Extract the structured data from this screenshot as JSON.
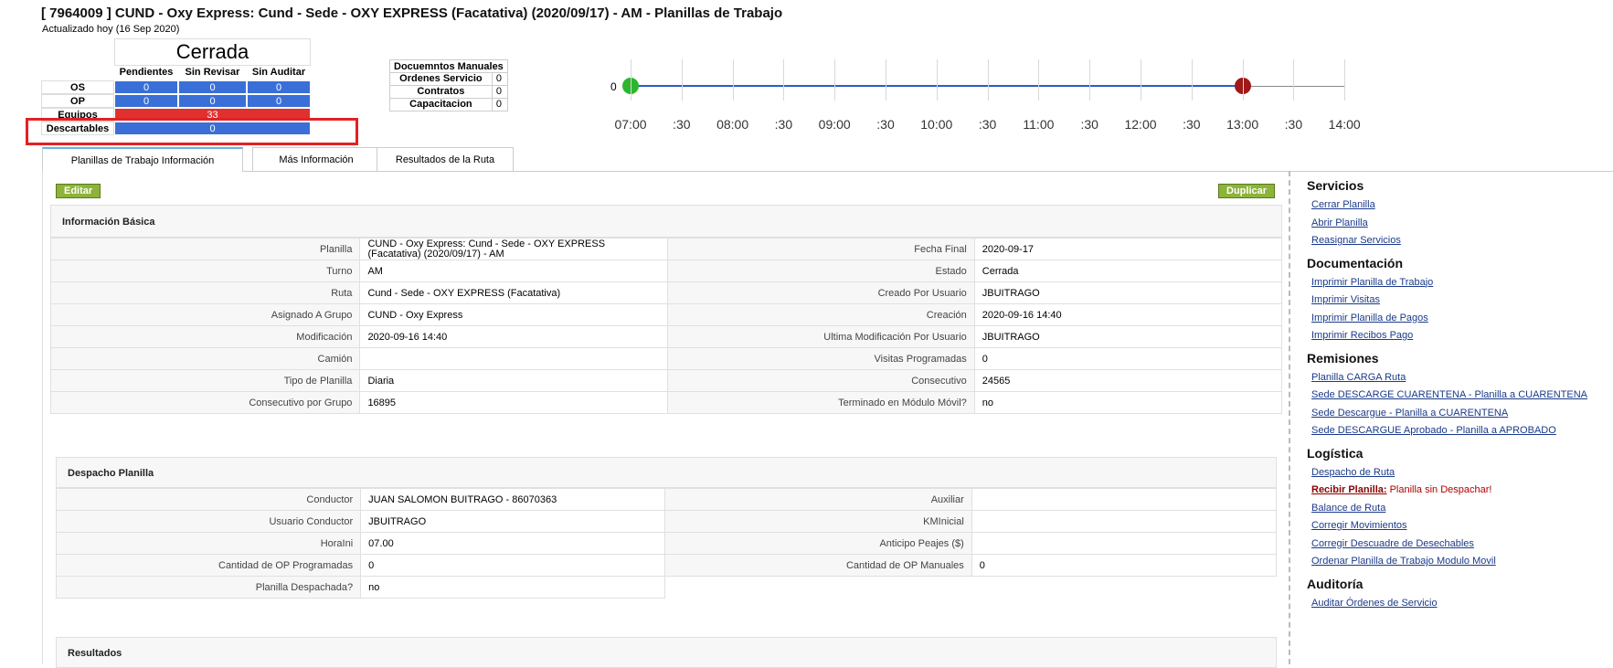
{
  "header": {
    "title": "[ 7964009 ] CUND - Oxy Express: Cund - Sede - OXY EXPRESS (Facatativa) (2020/09/17) - AM - Planillas de Trabajo",
    "updated": "Actualizado hoy (16 Sep 2020)"
  },
  "status": {
    "state": "Cerrada",
    "columns": [
      "Pendientes",
      "Sin Revisar",
      "Sin Auditar"
    ],
    "rows": [
      {
        "label": "OS",
        "values": [
          "0",
          "0",
          "0"
        ]
      },
      {
        "label": "OP",
        "values": [
          "0",
          "0",
          "0"
        ]
      }
    ],
    "equipos_label": "Equipos",
    "equipos_value": "33",
    "descartables_label": "Descartables",
    "descartables_value": "0"
  },
  "docs": {
    "title": "Docuemntos Manuales",
    "rows": [
      {
        "label": "Ordenes Servicio",
        "value": "0"
      },
      {
        "label": "Contratos",
        "value": "0"
      },
      {
        "label": "Capacitacion",
        "value": "0"
      }
    ]
  },
  "timeline": {
    "zero_label": "0",
    "labels": [
      "07:00",
      ":30",
      "08:00",
      ":30",
      "09:00",
      ":30",
      "10:00",
      ":30",
      "11:00",
      ":30",
      "12:00",
      ":30",
      "13:00",
      ":30",
      "14:00"
    ],
    "start_color": "#2db52d",
    "end_color": "#a01818"
  },
  "tabs": [
    {
      "label": "Planillas de Trabajo Información"
    },
    {
      "label": "Más Información"
    },
    {
      "label": "Resultados de la Ruta"
    }
  ],
  "buttons": {
    "edit": "Editar",
    "duplicate": "Duplicar"
  },
  "basic_info": {
    "title": "Información Básica",
    "left": [
      {
        "label": "Planilla",
        "value": "CUND - Oxy Express: Cund - Sede - OXY EXPRESS (Facatativa) (2020/09/17) - AM"
      },
      {
        "label": "Turno",
        "value": "AM"
      },
      {
        "label": "Ruta",
        "value": "Cund - Sede - OXY EXPRESS (Facatativa)"
      },
      {
        "label": "Asignado A Grupo",
        "value": "CUND - Oxy Express"
      },
      {
        "label": "Modificación",
        "value": "2020-09-16 14:40"
      },
      {
        "label": "Camión",
        "value": ""
      },
      {
        "label": "Tipo de Planilla",
        "value": "Diaria"
      },
      {
        "label": "Consecutivo por Grupo",
        "value": "16895"
      }
    ],
    "right": [
      {
        "label": "Fecha Final",
        "value": "2020-09-17"
      },
      {
        "label": "Estado",
        "value": "Cerrada"
      },
      {
        "label": "Creado Por Usuario",
        "value": "JBUITRAGO"
      },
      {
        "label": "Creación",
        "value": "2020-09-16 14:40"
      },
      {
        "label": "Ultima Modificación Por Usuario",
        "value": "JBUITRAGO"
      },
      {
        "label": "Visitas Programadas",
        "value": "0"
      },
      {
        "label": "Consecutivo",
        "value": "24565"
      },
      {
        "label": "Terminado en Módulo Móvil?",
        "value": "no"
      }
    ]
  },
  "dispatch": {
    "title": "Despacho Planilla",
    "left": [
      {
        "label": "Conductor",
        "value": "JUAN SALOMON BUITRAGO - 86070363"
      },
      {
        "label": "Usuario Conductor",
        "value": "JBUITRAGO"
      },
      {
        "label": "HoraIni",
        "value": "07.00"
      },
      {
        "label": "Cantidad de OP Programadas",
        "value": "0"
      },
      {
        "label": "Planilla Despachada?",
        "value": "no"
      }
    ],
    "right": [
      {
        "label": "Auxiliar",
        "value": ""
      },
      {
        "label": "KMInicial",
        "value": ""
      },
      {
        "label": "Anticipo Peajes ($)",
        "value": ""
      },
      {
        "label": "Cantidad de OP Manuales",
        "value": "0"
      }
    ]
  },
  "results": {
    "title": "Resultados"
  },
  "sidebar": {
    "sections": [
      {
        "title": "Servicios",
        "links": [
          "Cerrar Planilla",
          "Abrir Planilla",
          "Reasignar Servicios"
        ]
      },
      {
        "title": "Documentación",
        "links": [
          "Imprimir Planilla de Trabajo",
          "Imprimir Visitas",
          "Imprimir Planilla de Pagos",
          "Imprimir Recibos Pago"
        ]
      },
      {
        "title": "Remisiones",
        "links": [
          "Planilla CARGA Ruta",
          "Sede DESCARGE CUARENTENA - Planilla a CUARENTENA",
          "Sede Descargue - Planilla a CUARENTENA",
          "Sede DESCARGUE Aprobado - Planilla a APROBADO"
        ]
      },
      {
        "title": "Logística",
        "links": [
          "Despacho de Ruta",
          "Recibir Planilla:",
          "Balance de Ruta",
          "Corregir Movimientos",
          "Corregir Descuadre de Desechables",
          "Ordenar Planilla de Trabajo Modulo Movil"
        ]
      },
      {
        "title": "Auditoría",
        "links": [
          "Auditar Órdenes de Servicio"
        ]
      }
    ],
    "recibir_tail": " Planilla sin Despachar!"
  }
}
